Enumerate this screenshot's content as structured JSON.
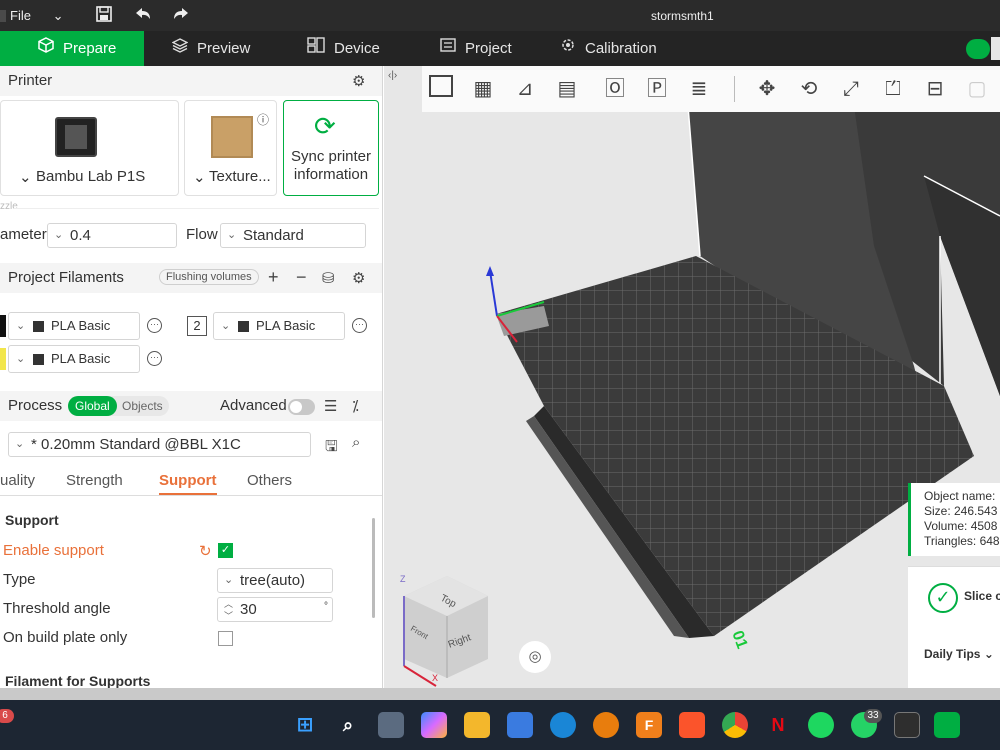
{
  "titlebar": {
    "file_label": "File",
    "window_title": "stormsmth1"
  },
  "tabs": [
    {
      "label": "Prepare",
      "icon": "cube-icon"
    },
    {
      "label": "Preview",
      "icon": "layers-icon"
    },
    {
      "label": "Device",
      "icon": "device-icon"
    },
    {
      "label": "Project",
      "icon": "project-icon"
    },
    {
      "label": "Calibration",
      "icon": "calibration-icon"
    }
  ],
  "printer": {
    "section_label": "Printer",
    "printer_name": "Bambu Lab P1S",
    "plate_label": "Texture...",
    "sync_label": "Sync printer information",
    "nozzle_label": "zzle",
    "diameter_label": "ameter",
    "diameter_value": "0.4",
    "flow_label": "Flow",
    "flow_value": "Standard"
  },
  "filaments": {
    "section_label": "Project Filaments",
    "flushing_label": "Flushing volumes",
    "slots": [
      {
        "name": "PLA Basic",
        "color": "#111111"
      },
      {
        "number": "2",
        "name": "PLA Basic",
        "color": "#ffffff"
      },
      {
        "name": "PLA Basic",
        "color": "#f2e64b"
      }
    ]
  },
  "process": {
    "section_label": "Process",
    "global_label": "Global",
    "objects_label": "Objects",
    "advanced_label": "Advanced",
    "preset_value": "* 0.20mm Standard @BBL X1C",
    "subtabs": [
      "uality",
      "Strength",
      "Support",
      "Others"
    ],
    "active_subtab": "Support"
  },
  "support": {
    "group_title": "Support",
    "enable_label": "Enable support",
    "enable_color": "#e9713a",
    "type_label": "Type",
    "type_value": "tree(auto)",
    "threshold_label": "Threshold angle",
    "threshold_value": "30",
    "threshold_unit": "°",
    "build_plate_label": "On build plate only",
    "filament_group_title": "Filament for Supports"
  },
  "viewport": {
    "object_info": {
      "name": "Object name:",
      "size": "Size: 246.543",
      "volume": "Volume: 4508",
      "triangles": "Triangles: 648"
    },
    "slice_label": "Slice c",
    "tips_label": "Daily Tips",
    "cube_top": "Top",
    "cube_right": "Right",
    "cube_front": "Front",
    "axis_z": "Z",
    "axis_x": "X",
    "plate_number": "01"
  },
  "taskbar": {
    "notification_count": "6",
    "whatsapp_badge": "33"
  },
  "colors": {
    "accent": "#00ae42",
    "active_subtab": "#e9713a"
  }
}
